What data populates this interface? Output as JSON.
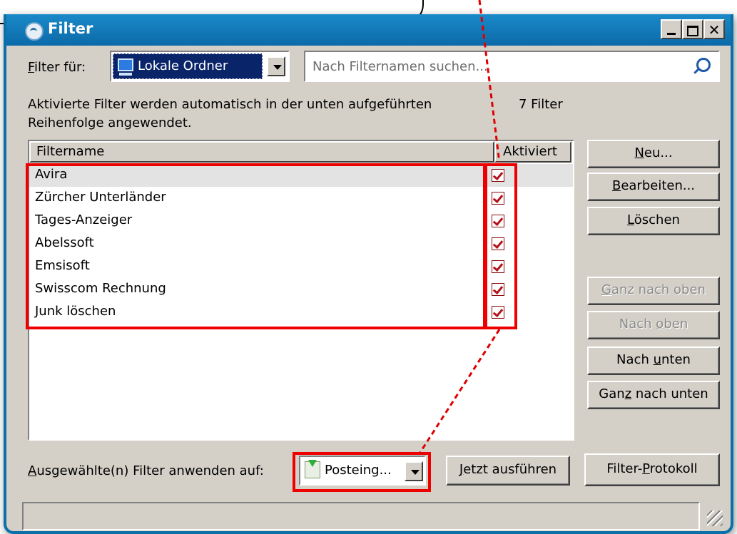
{
  "window": {
    "title": "Filter"
  },
  "filter_for": {
    "label_prefix": "F",
    "label_rest": "ilter für:",
    "value": "Lokale Ordner"
  },
  "search": {
    "placeholder": "Nach Filternamen suchen..."
  },
  "info": {
    "line1": "Aktivierte Filter werden automatisch in der unten aufgeführten",
    "line2": "Reihenfolge angewendet.",
    "count": "7 Filter"
  },
  "list": {
    "columns": {
      "name": "Filtername",
      "active": "Aktiviert"
    },
    "rows": [
      {
        "name": "Avira",
        "active": true
      },
      {
        "name": "Zürcher Unterländer",
        "active": true
      },
      {
        "name": "Tages-Anzeiger",
        "active": true
      },
      {
        "name": "Abelssoft",
        "active": true
      },
      {
        "name": "Emsisoft",
        "active": true
      },
      {
        "name": "Swisscom Rechnung",
        "active": true
      },
      {
        "name": "Junk löschen",
        "active": true
      }
    ]
  },
  "buttons": {
    "new": {
      "u": "N",
      "rest": "eu..."
    },
    "edit": {
      "u": "B",
      "rest": "earbeiten..."
    },
    "delete": {
      "u": "L",
      "rest": "öschen"
    },
    "top": {
      "u": "G",
      "rest": "anz nach oben"
    },
    "up_pre": "Nach ",
    "up_u": "o",
    "up_rest": "ben",
    "down_pre": "Nach ",
    "down_u": "u",
    "down_rest": "nten",
    "bottom_pre": "Gan",
    "bottom_u": "z",
    "bottom_rest": " nach unten",
    "log_pre": "Filter-",
    "log_u": "P",
    "log_rest": "rotokoll",
    "run": {
      "u": "J",
      "rest": "etzt ausführen"
    }
  },
  "apply": {
    "label_u": "A",
    "label_rest": "usgewählte(n) Filter anwenden auf:",
    "target": "Posteing..."
  },
  "colors": {
    "titlebar": "#0c6aa9",
    "highlight": "#ee0000",
    "check": "#b3131a"
  }
}
